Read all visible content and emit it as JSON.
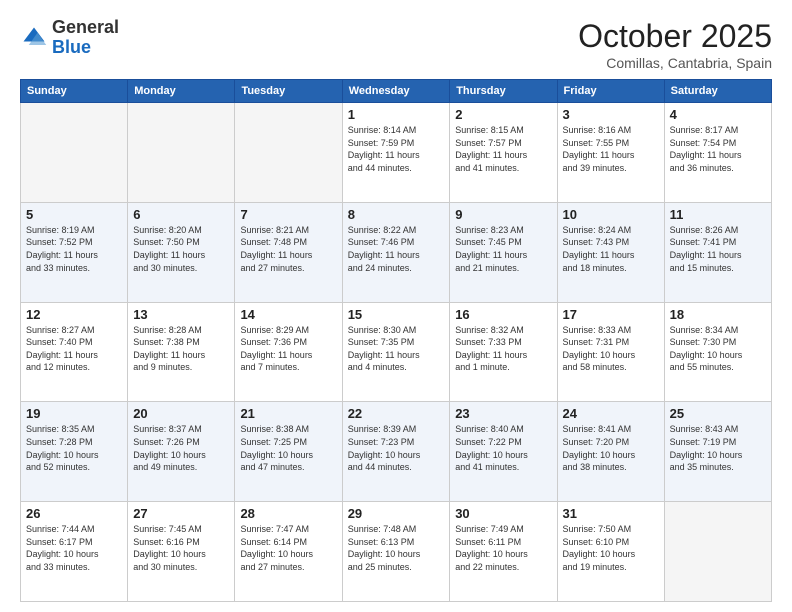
{
  "header": {
    "logo_general": "General",
    "logo_blue": "Blue",
    "month": "October 2025",
    "location": "Comillas, Cantabria, Spain"
  },
  "days_of_week": [
    "Sunday",
    "Monday",
    "Tuesday",
    "Wednesday",
    "Thursday",
    "Friday",
    "Saturday"
  ],
  "weeks": [
    [
      {
        "day": "",
        "info": ""
      },
      {
        "day": "",
        "info": ""
      },
      {
        "day": "",
        "info": ""
      },
      {
        "day": "1",
        "info": "Sunrise: 8:14 AM\nSunset: 7:59 PM\nDaylight: 11 hours\nand 44 minutes."
      },
      {
        "day": "2",
        "info": "Sunrise: 8:15 AM\nSunset: 7:57 PM\nDaylight: 11 hours\nand 41 minutes."
      },
      {
        "day": "3",
        "info": "Sunrise: 8:16 AM\nSunset: 7:55 PM\nDaylight: 11 hours\nand 39 minutes."
      },
      {
        "day": "4",
        "info": "Sunrise: 8:17 AM\nSunset: 7:54 PM\nDaylight: 11 hours\nand 36 minutes."
      }
    ],
    [
      {
        "day": "5",
        "info": "Sunrise: 8:19 AM\nSunset: 7:52 PM\nDaylight: 11 hours\nand 33 minutes."
      },
      {
        "day": "6",
        "info": "Sunrise: 8:20 AM\nSunset: 7:50 PM\nDaylight: 11 hours\nand 30 minutes."
      },
      {
        "day": "7",
        "info": "Sunrise: 8:21 AM\nSunset: 7:48 PM\nDaylight: 11 hours\nand 27 minutes."
      },
      {
        "day": "8",
        "info": "Sunrise: 8:22 AM\nSunset: 7:46 PM\nDaylight: 11 hours\nand 24 minutes."
      },
      {
        "day": "9",
        "info": "Sunrise: 8:23 AM\nSunset: 7:45 PM\nDaylight: 11 hours\nand 21 minutes."
      },
      {
        "day": "10",
        "info": "Sunrise: 8:24 AM\nSunset: 7:43 PM\nDaylight: 11 hours\nand 18 minutes."
      },
      {
        "day": "11",
        "info": "Sunrise: 8:26 AM\nSunset: 7:41 PM\nDaylight: 11 hours\nand 15 minutes."
      }
    ],
    [
      {
        "day": "12",
        "info": "Sunrise: 8:27 AM\nSunset: 7:40 PM\nDaylight: 11 hours\nand 12 minutes."
      },
      {
        "day": "13",
        "info": "Sunrise: 8:28 AM\nSunset: 7:38 PM\nDaylight: 11 hours\nand 9 minutes."
      },
      {
        "day": "14",
        "info": "Sunrise: 8:29 AM\nSunset: 7:36 PM\nDaylight: 11 hours\nand 7 minutes."
      },
      {
        "day": "15",
        "info": "Sunrise: 8:30 AM\nSunset: 7:35 PM\nDaylight: 11 hours\nand 4 minutes."
      },
      {
        "day": "16",
        "info": "Sunrise: 8:32 AM\nSunset: 7:33 PM\nDaylight: 11 hours\nand 1 minute."
      },
      {
        "day": "17",
        "info": "Sunrise: 8:33 AM\nSunset: 7:31 PM\nDaylight: 10 hours\nand 58 minutes."
      },
      {
        "day": "18",
        "info": "Sunrise: 8:34 AM\nSunset: 7:30 PM\nDaylight: 10 hours\nand 55 minutes."
      }
    ],
    [
      {
        "day": "19",
        "info": "Sunrise: 8:35 AM\nSunset: 7:28 PM\nDaylight: 10 hours\nand 52 minutes."
      },
      {
        "day": "20",
        "info": "Sunrise: 8:37 AM\nSunset: 7:26 PM\nDaylight: 10 hours\nand 49 minutes."
      },
      {
        "day": "21",
        "info": "Sunrise: 8:38 AM\nSunset: 7:25 PM\nDaylight: 10 hours\nand 47 minutes."
      },
      {
        "day": "22",
        "info": "Sunrise: 8:39 AM\nSunset: 7:23 PM\nDaylight: 10 hours\nand 44 minutes."
      },
      {
        "day": "23",
        "info": "Sunrise: 8:40 AM\nSunset: 7:22 PM\nDaylight: 10 hours\nand 41 minutes."
      },
      {
        "day": "24",
        "info": "Sunrise: 8:41 AM\nSunset: 7:20 PM\nDaylight: 10 hours\nand 38 minutes."
      },
      {
        "day": "25",
        "info": "Sunrise: 8:43 AM\nSunset: 7:19 PM\nDaylight: 10 hours\nand 35 minutes."
      }
    ],
    [
      {
        "day": "26",
        "info": "Sunrise: 7:44 AM\nSunset: 6:17 PM\nDaylight: 10 hours\nand 33 minutes."
      },
      {
        "day": "27",
        "info": "Sunrise: 7:45 AM\nSunset: 6:16 PM\nDaylight: 10 hours\nand 30 minutes."
      },
      {
        "day": "28",
        "info": "Sunrise: 7:47 AM\nSunset: 6:14 PM\nDaylight: 10 hours\nand 27 minutes."
      },
      {
        "day": "29",
        "info": "Sunrise: 7:48 AM\nSunset: 6:13 PM\nDaylight: 10 hours\nand 25 minutes."
      },
      {
        "day": "30",
        "info": "Sunrise: 7:49 AM\nSunset: 6:11 PM\nDaylight: 10 hours\nand 22 minutes."
      },
      {
        "day": "31",
        "info": "Sunrise: 7:50 AM\nSunset: 6:10 PM\nDaylight: 10 hours\nand 19 minutes."
      },
      {
        "day": "",
        "info": ""
      }
    ]
  ]
}
